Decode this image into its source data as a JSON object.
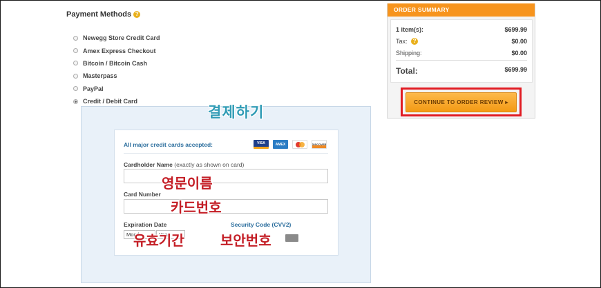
{
  "payment": {
    "title": "Payment Methods",
    "help_icon": "?",
    "methods": [
      {
        "label": "Newegg Store Credit Card",
        "selected": false
      },
      {
        "label": "Amex Express Checkout",
        "selected": false
      },
      {
        "label": "Bitcoin / Bitcoin Cash",
        "selected": false
      },
      {
        "label": "Masterpass",
        "selected": false
      },
      {
        "label": "PayPal",
        "selected": false
      },
      {
        "label": "Credit / Debit Card",
        "selected": true
      }
    ]
  },
  "card_form": {
    "accepted_label": "All major credit cards accepted:",
    "card_logos": [
      "VISA",
      "AMEX",
      "mastercard",
      "DISCOVER"
    ],
    "cardholder_label": "Cardholder Name",
    "cardholder_hint": "(exactly as shown on card)",
    "cardholder_value": "",
    "card_number_label": "Card Number",
    "card_number_value": "",
    "expiration_label": "Expiration Date",
    "month_value": "Month",
    "year_value": "Year",
    "security_label": "Security Code (CVV2)"
  },
  "annotations": {
    "checkout": "결제하기",
    "english_name": "영문이름",
    "card_number": "카드번호",
    "expiry": "유효기간",
    "security_code": "보안번호"
  },
  "order_summary": {
    "header": "ORDER SUMMARY",
    "items_label": "1 item(s):",
    "items_value": "$699.99",
    "tax_label": "Tax:",
    "tax_value": "$0.00",
    "shipping_label": "Shipping:",
    "shipping_value": "$0.00",
    "total_label": "Total:",
    "total_value": "$699.99",
    "continue_label": "CONTINUE TO ORDER REVIEW",
    "continue_arrow": "▸"
  },
  "colors": {
    "accent_orange": "#f7941d",
    "highlight_red": "#e11b22",
    "link_blue": "#2d6f9e",
    "annotation_red": "#c41e26",
    "annotation_teal": "#2f9bb5"
  }
}
